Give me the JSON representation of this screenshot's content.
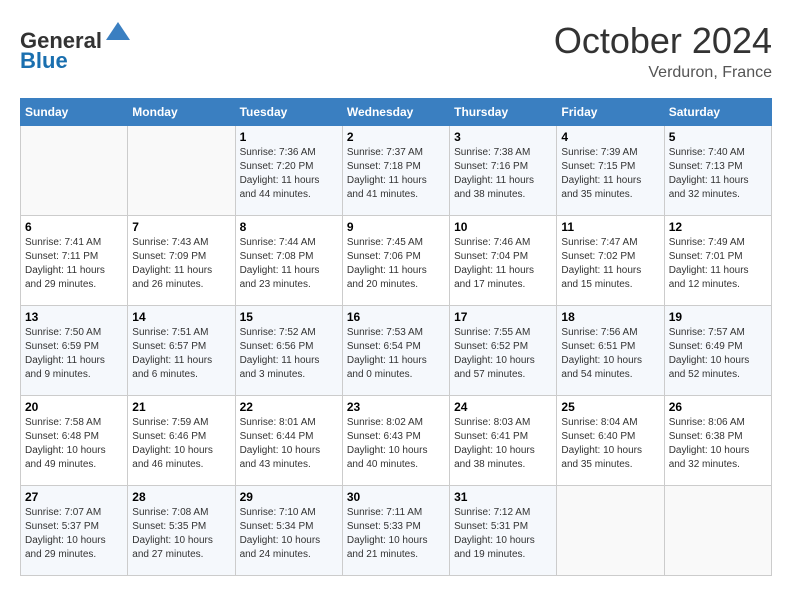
{
  "header": {
    "logo_line1": "General",
    "logo_line2": "Blue",
    "month": "October 2024",
    "location": "Verduron, France"
  },
  "days_of_week": [
    "Sunday",
    "Monday",
    "Tuesday",
    "Wednesday",
    "Thursday",
    "Friday",
    "Saturday"
  ],
  "weeks": [
    [
      {
        "day": "",
        "sunrise": "",
        "sunset": "",
        "daylight": ""
      },
      {
        "day": "",
        "sunrise": "",
        "sunset": "",
        "daylight": ""
      },
      {
        "day": "1",
        "sunrise": "Sunrise: 7:36 AM",
        "sunset": "Sunset: 7:20 PM",
        "daylight": "Daylight: 11 hours and 44 minutes."
      },
      {
        "day": "2",
        "sunrise": "Sunrise: 7:37 AM",
        "sunset": "Sunset: 7:18 PM",
        "daylight": "Daylight: 11 hours and 41 minutes."
      },
      {
        "day": "3",
        "sunrise": "Sunrise: 7:38 AM",
        "sunset": "Sunset: 7:16 PM",
        "daylight": "Daylight: 11 hours and 38 minutes."
      },
      {
        "day": "4",
        "sunrise": "Sunrise: 7:39 AM",
        "sunset": "Sunset: 7:15 PM",
        "daylight": "Daylight: 11 hours and 35 minutes."
      },
      {
        "day": "5",
        "sunrise": "Sunrise: 7:40 AM",
        "sunset": "Sunset: 7:13 PM",
        "daylight": "Daylight: 11 hours and 32 minutes."
      }
    ],
    [
      {
        "day": "6",
        "sunrise": "Sunrise: 7:41 AM",
        "sunset": "Sunset: 7:11 PM",
        "daylight": "Daylight: 11 hours and 29 minutes."
      },
      {
        "day": "7",
        "sunrise": "Sunrise: 7:43 AM",
        "sunset": "Sunset: 7:09 PM",
        "daylight": "Daylight: 11 hours and 26 minutes."
      },
      {
        "day": "8",
        "sunrise": "Sunrise: 7:44 AM",
        "sunset": "Sunset: 7:08 PM",
        "daylight": "Daylight: 11 hours and 23 minutes."
      },
      {
        "day": "9",
        "sunrise": "Sunrise: 7:45 AM",
        "sunset": "Sunset: 7:06 PM",
        "daylight": "Daylight: 11 hours and 20 minutes."
      },
      {
        "day": "10",
        "sunrise": "Sunrise: 7:46 AM",
        "sunset": "Sunset: 7:04 PM",
        "daylight": "Daylight: 11 hours and 17 minutes."
      },
      {
        "day": "11",
        "sunrise": "Sunrise: 7:47 AM",
        "sunset": "Sunset: 7:02 PM",
        "daylight": "Daylight: 11 hours and 15 minutes."
      },
      {
        "day": "12",
        "sunrise": "Sunrise: 7:49 AM",
        "sunset": "Sunset: 7:01 PM",
        "daylight": "Daylight: 11 hours and 12 minutes."
      }
    ],
    [
      {
        "day": "13",
        "sunrise": "Sunrise: 7:50 AM",
        "sunset": "Sunset: 6:59 PM",
        "daylight": "Daylight: 11 hours and 9 minutes."
      },
      {
        "day": "14",
        "sunrise": "Sunrise: 7:51 AM",
        "sunset": "Sunset: 6:57 PM",
        "daylight": "Daylight: 11 hours and 6 minutes."
      },
      {
        "day": "15",
        "sunrise": "Sunrise: 7:52 AM",
        "sunset": "Sunset: 6:56 PM",
        "daylight": "Daylight: 11 hours and 3 minutes."
      },
      {
        "day": "16",
        "sunrise": "Sunrise: 7:53 AM",
        "sunset": "Sunset: 6:54 PM",
        "daylight": "Daylight: 11 hours and 0 minutes."
      },
      {
        "day": "17",
        "sunrise": "Sunrise: 7:55 AM",
        "sunset": "Sunset: 6:52 PM",
        "daylight": "Daylight: 10 hours and 57 minutes."
      },
      {
        "day": "18",
        "sunrise": "Sunrise: 7:56 AM",
        "sunset": "Sunset: 6:51 PM",
        "daylight": "Daylight: 10 hours and 54 minutes."
      },
      {
        "day": "19",
        "sunrise": "Sunrise: 7:57 AM",
        "sunset": "Sunset: 6:49 PM",
        "daylight": "Daylight: 10 hours and 52 minutes."
      }
    ],
    [
      {
        "day": "20",
        "sunrise": "Sunrise: 7:58 AM",
        "sunset": "Sunset: 6:48 PM",
        "daylight": "Daylight: 10 hours and 49 minutes."
      },
      {
        "day": "21",
        "sunrise": "Sunrise: 7:59 AM",
        "sunset": "Sunset: 6:46 PM",
        "daylight": "Daylight: 10 hours and 46 minutes."
      },
      {
        "day": "22",
        "sunrise": "Sunrise: 8:01 AM",
        "sunset": "Sunset: 6:44 PM",
        "daylight": "Daylight: 10 hours and 43 minutes."
      },
      {
        "day": "23",
        "sunrise": "Sunrise: 8:02 AM",
        "sunset": "Sunset: 6:43 PM",
        "daylight": "Daylight: 10 hours and 40 minutes."
      },
      {
        "day": "24",
        "sunrise": "Sunrise: 8:03 AM",
        "sunset": "Sunset: 6:41 PM",
        "daylight": "Daylight: 10 hours and 38 minutes."
      },
      {
        "day": "25",
        "sunrise": "Sunrise: 8:04 AM",
        "sunset": "Sunset: 6:40 PM",
        "daylight": "Daylight: 10 hours and 35 minutes."
      },
      {
        "day": "26",
        "sunrise": "Sunrise: 8:06 AM",
        "sunset": "Sunset: 6:38 PM",
        "daylight": "Daylight: 10 hours and 32 minutes."
      }
    ],
    [
      {
        "day": "27",
        "sunrise": "Sunrise: 7:07 AM",
        "sunset": "Sunset: 5:37 PM",
        "daylight": "Daylight: 10 hours and 29 minutes."
      },
      {
        "day": "28",
        "sunrise": "Sunrise: 7:08 AM",
        "sunset": "Sunset: 5:35 PM",
        "daylight": "Daylight: 10 hours and 27 minutes."
      },
      {
        "day": "29",
        "sunrise": "Sunrise: 7:10 AM",
        "sunset": "Sunset: 5:34 PM",
        "daylight": "Daylight: 10 hours and 24 minutes."
      },
      {
        "day": "30",
        "sunrise": "Sunrise: 7:11 AM",
        "sunset": "Sunset: 5:33 PM",
        "daylight": "Daylight: 10 hours and 21 minutes."
      },
      {
        "day": "31",
        "sunrise": "Sunrise: 7:12 AM",
        "sunset": "Sunset: 5:31 PM",
        "daylight": "Daylight: 10 hours and 19 minutes."
      },
      {
        "day": "",
        "sunrise": "",
        "sunset": "",
        "daylight": ""
      },
      {
        "day": "",
        "sunrise": "",
        "sunset": "",
        "daylight": ""
      }
    ]
  ]
}
